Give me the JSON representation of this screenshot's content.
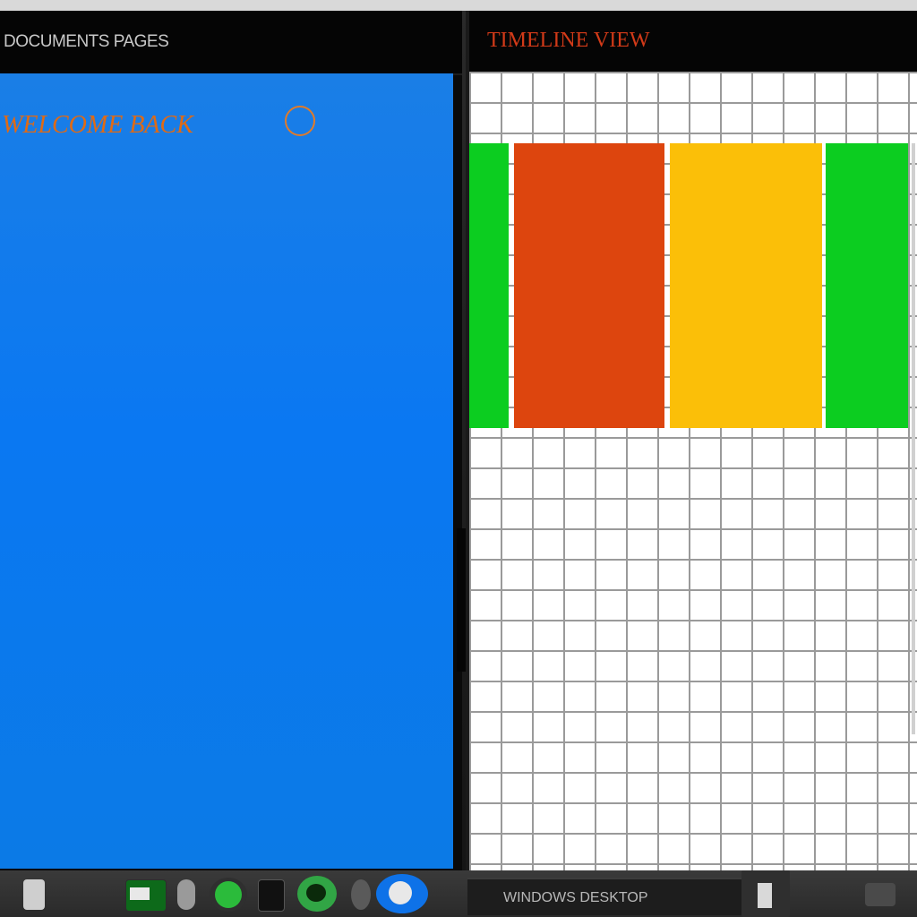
{
  "left_window": {
    "title": "DOCUMENTS PAGES",
    "heading": "WELCOME BACK",
    "status": ""
  },
  "right_window": {
    "title": "TIMELINE VIEW"
  },
  "blocks": [
    {
      "name": "green-a",
      "color": "#0ccd20"
    },
    {
      "name": "red",
      "color": "#dd450e"
    },
    {
      "name": "yellow",
      "color": "#fbbf08"
    },
    {
      "name": "green-b",
      "color": "#0ccd20"
    }
  ],
  "taskbar": {
    "items": [
      "document-icon",
      "store-icon",
      "bulb-icon",
      "globe-icon",
      "box-icon",
      "chat-icon",
      "gear-icon",
      "search-icon"
    ],
    "active_window_label": "WINDOWS DESKTOP"
  },
  "colors": {
    "desktop_blue": "#0a78f2",
    "accent_orange": "#e06a14",
    "accent_red": "#d23a18"
  }
}
